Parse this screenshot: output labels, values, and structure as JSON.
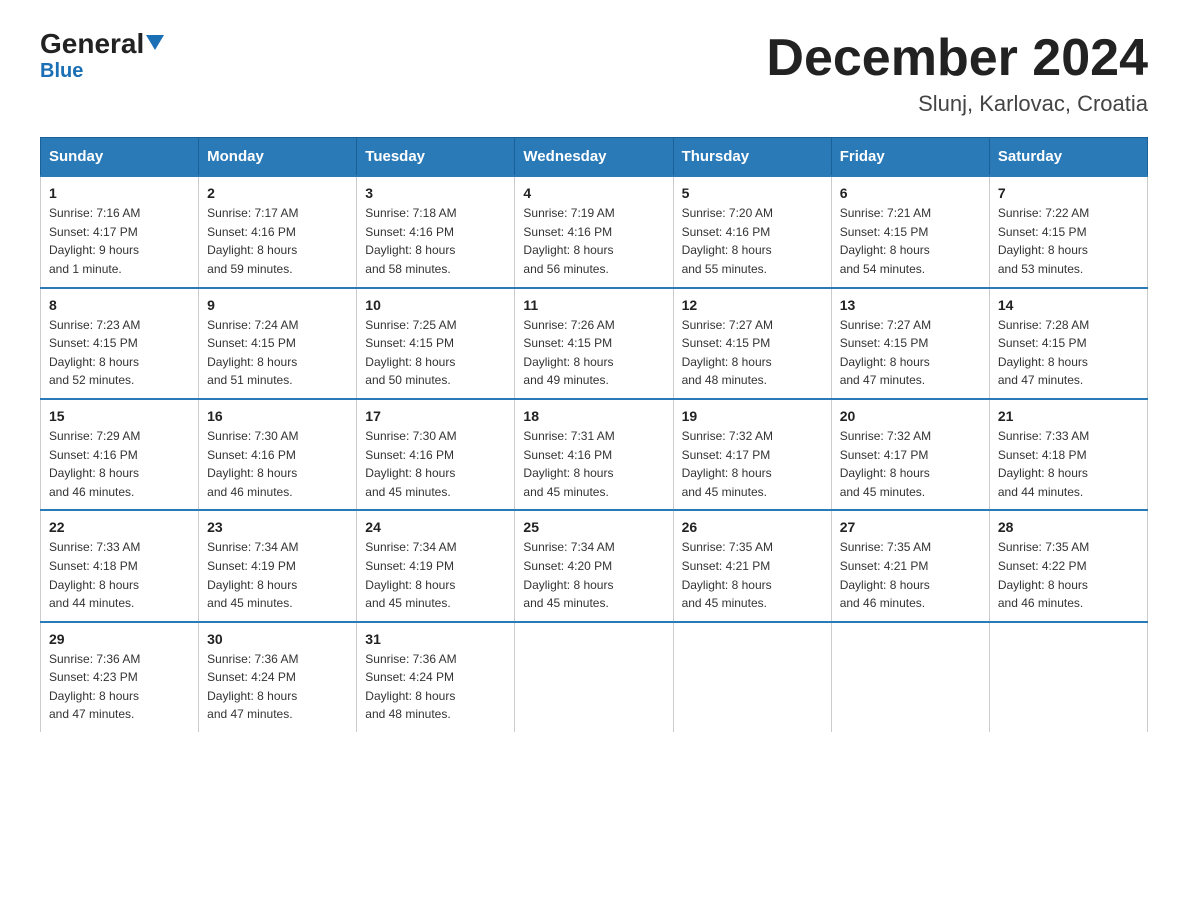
{
  "logo": {
    "general": "General",
    "blue": "Blue",
    "triangle": "▲"
  },
  "header": {
    "month_year": "December 2024",
    "location": "Slunj, Karlovac, Croatia"
  },
  "weekdays": [
    "Sunday",
    "Monday",
    "Tuesday",
    "Wednesday",
    "Thursday",
    "Friday",
    "Saturday"
  ],
  "weeks": [
    [
      {
        "day": "1",
        "sunrise": "7:16 AM",
        "sunset": "4:17 PM",
        "daylight": "9 hours and 1 minute."
      },
      {
        "day": "2",
        "sunrise": "7:17 AM",
        "sunset": "4:16 PM",
        "daylight": "8 hours and 59 minutes."
      },
      {
        "day": "3",
        "sunrise": "7:18 AM",
        "sunset": "4:16 PM",
        "daylight": "8 hours and 58 minutes."
      },
      {
        "day": "4",
        "sunrise": "7:19 AM",
        "sunset": "4:16 PM",
        "daylight": "8 hours and 56 minutes."
      },
      {
        "day": "5",
        "sunrise": "7:20 AM",
        "sunset": "4:16 PM",
        "daylight": "8 hours and 55 minutes."
      },
      {
        "day": "6",
        "sunrise": "7:21 AM",
        "sunset": "4:15 PM",
        "daylight": "8 hours and 54 minutes."
      },
      {
        "day": "7",
        "sunrise": "7:22 AM",
        "sunset": "4:15 PM",
        "daylight": "8 hours and 53 minutes."
      }
    ],
    [
      {
        "day": "8",
        "sunrise": "7:23 AM",
        "sunset": "4:15 PM",
        "daylight": "8 hours and 52 minutes."
      },
      {
        "day": "9",
        "sunrise": "7:24 AM",
        "sunset": "4:15 PM",
        "daylight": "8 hours and 51 minutes."
      },
      {
        "day": "10",
        "sunrise": "7:25 AM",
        "sunset": "4:15 PM",
        "daylight": "8 hours and 50 minutes."
      },
      {
        "day": "11",
        "sunrise": "7:26 AM",
        "sunset": "4:15 PM",
        "daylight": "8 hours and 49 minutes."
      },
      {
        "day": "12",
        "sunrise": "7:27 AM",
        "sunset": "4:15 PM",
        "daylight": "8 hours and 48 minutes."
      },
      {
        "day": "13",
        "sunrise": "7:27 AM",
        "sunset": "4:15 PM",
        "daylight": "8 hours and 47 minutes."
      },
      {
        "day": "14",
        "sunrise": "7:28 AM",
        "sunset": "4:15 PM",
        "daylight": "8 hours and 47 minutes."
      }
    ],
    [
      {
        "day": "15",
        "sunrise": "7:29 AM",
        "sunset": "4:16 PM",
        "daylight": "8 hours and 46 minutes."
      },
      {
        "day": "16",
        "sunrise": "7:30 AM",
        "sunset": "4:16 PM",
        "daylight": "8 hours and 46 minutes."
      },
      {
        "day": "17",
        "sunrise": "7:30 AM",
        "sunset": "4:16 PM",
        "daylight": "8 hours and 45 minutes."
      },
      {
        "day": "18",
        "sunrise": "7:31 AM",
        "sunset": "4:16 PM",
        "daylight": "8 hours and 45 minutes."
      },
      {
        "day": "19",
        "sunrise": "7:32 AM",
        "sunset": "4:17 PM",
        "daylight": "8 hours and 45 minutes."
      },
      {
        "day": "20",
        "sunrise": "7:32 AM",
        "sunset": "4:17 PM",
        "daylight": "8 hours and 45 minutes."
      },
      {
        "day": "21",
        "sunrise": "7:33 AM",
        "sunset": "4:18 PM",
        "daylight": "8 hours and 44 minutes."
      }
    ],
    [
      {
        "day": "22",
        "sunrise": "7:33 AM",
        "sunset": "4:18 PM",
        "daylight": "8 hours and 44 minutes."
      },
      {
        "day": "23",
        "sunrise": "7:34 AM",
        "sunset": "4:19 PM",
        "daylight": "8 hours and 45 minutes."
      },
      {
        "day": "24",
        "sunrise": "7:34 AM",
        "sunset": "4:19 PM",
        "daylight": "8 hours and 45 minutes."
      },
      {
        "day": "25",
        "sunrise": "7:34 AM",
        "sunset": "4:20 PM",
        "daylight": "8 hours and 45 minutes."
      },
      {
        "day": "26",
        "sunrise": "7:35 AM",
        "sunset": "4:21 PM",
        "daylight": "8 hours and 45 minutes."
      },
      {
        "day": "27",
        "sunrise": "7:35 AM",
        "sunset": "4:21 PM",
        "daylight": "8 hours and 46 minutes."
      },
      {
        "day": "28",
        "sunrise": "7:35 AM",
        "sunset": "4:22 PM",
        "daylight": "8 hours and 46 minutes."
      }
    ],
    [
      {
        "day": "29",
        "sunrise": "7:36 AM",
        "sunset": "4:23 PM",
        "daylight": "8 hours and 47 minutes."
      },
      {
        "day": "30",
        "sunrise": "7:36 AM",
        "sunset": "4:24 PM",
        "daylight": "8 hours and 47 minutes."
      },
      {
        "day": "31",
        "sunrise": "7:36 AM",
        "sunset": "4:24 PM",
        "daylight": "8 hours and 48 minutes."
      },
      null,
      null,
      null,
      null
    ]
  ],
  "labels": {
    "sunrise": "Sunrise:",
    "sunset": "Sunset:",
    "daylight": "Daylight:"
  }
}
